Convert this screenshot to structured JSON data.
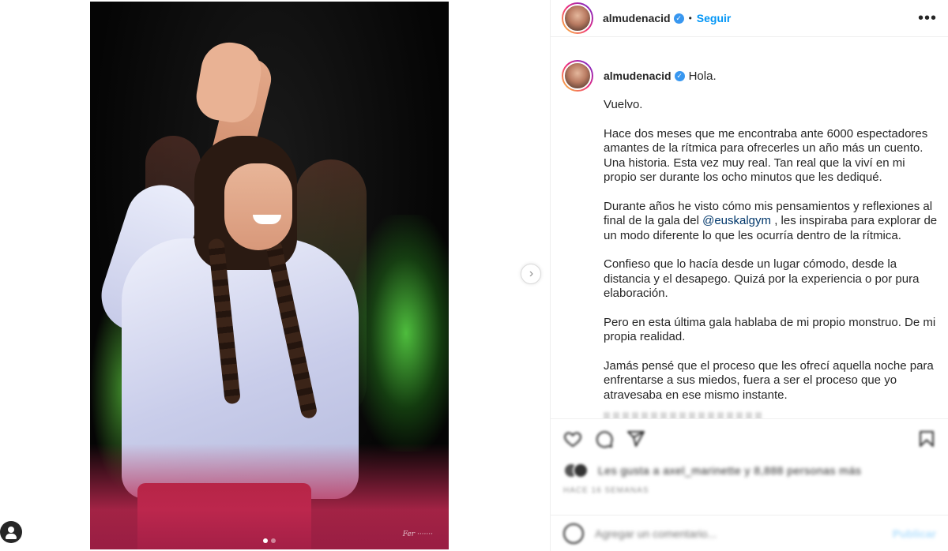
{
  "post": {
    "username": "almudenacid",
    "verified": true,
    "separator": "•",
    "follow_label": "Seguir",
    "more_icon": "more-options-icon"
  },
  "media": {
    "signature": "Fer ·······",
    "carousel": {
      "slides": 2,
      "current": 1
    },
    "next_icon": "chevron-right-icon"
  },
  "caption": {
    "username": "almudenacid",
    "greeting": "Hola.",
    "paragraphs": [
      "Vuelvo.",
      "Hace dos meses que me encontraba ante 6000 espectadores amantes de la rítmica para ofrecerles un año más un cuento. Una historia. Esta vez muy real. Tan real que la viví en mi propio ser durante los ocho minutos que les dediqué.",
      "Confieso que lo hacía desde un lugar cómodo, desde la distancia y el desapego. Quizá por la experiencia o por pura elaboración.",
      "Pero en esta última gala hablaba de mi propio monstruo. De mi propia realidad.",
      "Jamás pensé que el proceso que les ofrecí aquella noche para enfrentarse a sus miedos, fuera a ser el proceso que yo atravesaba en ese mismo instante."
    ],
    "mention_paragraph": {
      "before": "Durante años he visto cómo mis pensamientos y reflexiones al final de la gala del ",
      "mention": "@euskalgym",
      "after": " , les inspiraba para explorar de un modo diferente lo que les ocurría dentro de la rítmica."
    }
  },
  "actions": {
    "icons": [
      "heart-icon",
      "comment-icon",
      "share-icon",
      "bookmark-icon"
    ]
  },
  "likes": {
    "text": "Les gusta a axel_marinette y 8,888 personas más"
  },
  "date": {
    "text": "Hace 16 semanas"
  },
  "comment": {
    "placeholder": "Agregar un comentario...",
    "publish_label": "Publicar",
    "emoji_icon": "emoji-icon"
  },
  "colors": {
    "accent": "#0095f6",
    "verified": "#3897f0",
    "mention": "#00376b",
    "text": "#262626",
    "muted": "#8e8e8e"
  }
}
